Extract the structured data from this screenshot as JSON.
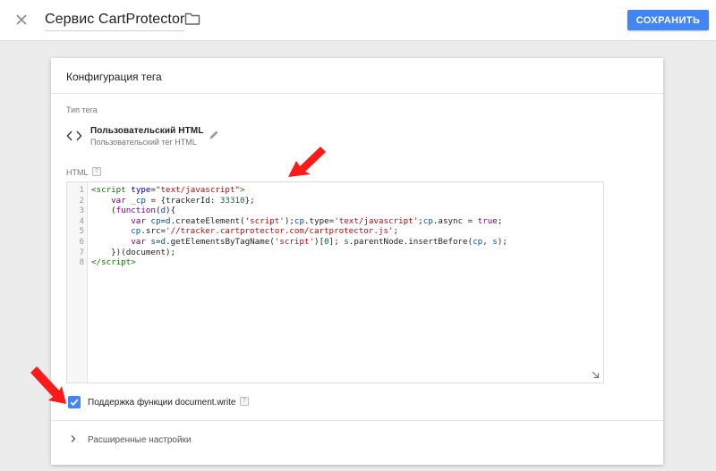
{
  "header": {
    "title": "Сервис CartProtector",
    "save_label": "СОХРАНИТЬ",
    "close_icon": "close-icon",
    "folder_icon": "folder-icon"
  },
  "card": {
    "title": "Конфигурация тега",
    "tag_type": {
      "label": "Тип тега",
      "name": "Пользовательский HTML",
      "description": "Пользовательский тег HTML",
      "icon": "code-brackets-icon"
    },
    "html": {
      "label": "HTML",
      "help": "?",
      "line_numbers": [
        "1",
        "2",
        "3",
        "4",
        "5",
        "6",
        "7",
        "8"
      ]
    },
    "document_write": {
      "label": "Поддержка функции document.write",
      "checked": true,
      "help": "?"
    },
    "advanced": {
      "label": "Расширенные настройки"
    }
  },
  "colors": {
    "accent": "#4285f4",
    "annotation_arrow": "#ff1a1a"
  }
}
